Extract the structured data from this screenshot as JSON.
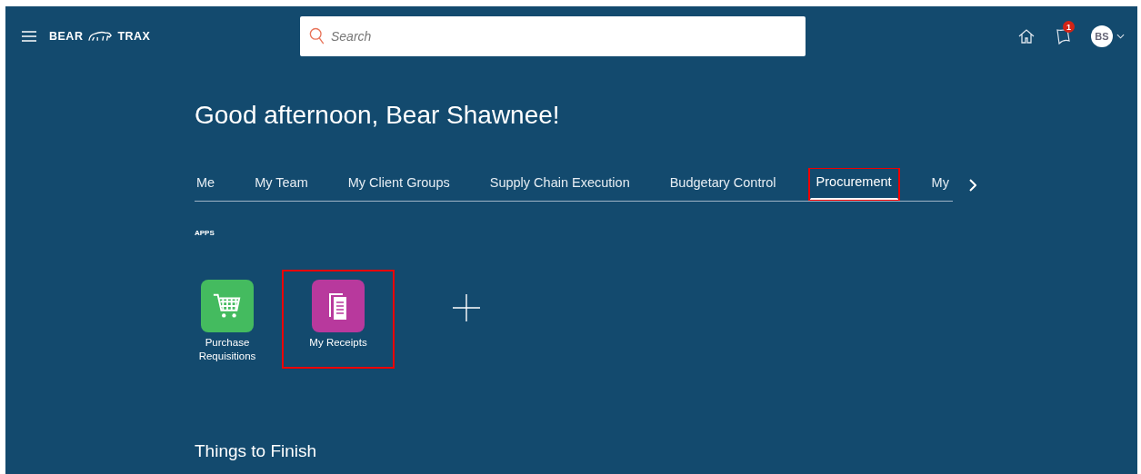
{
  "header": {
    "logo_left": "BEAR",
    "logo_right": "TRAX",
    "search": {
      "placeholder": "Search"
    },
    "notification_count": "1",
    "avatar_initials": "BS"
  },
  "greeting": "Good afternoon, Bear Shawnee!",
  "tabs": [
    {
      "label": "Me",
      "selected": false,
      "highlighted": false
    },
    {
      "label": "My Team",
      "selected": false,
      "highlighted": false
    },
    {
      "label": "My Client Groups",
      "selected": false,
      "highlighted": false
    },
    {
      "label": "Supply Chain Execution",
      "selected": false,
      "highlighted": false
    },
    {
      "label": "Budgetary Control",
      "selected": false,
      "highlighted": false
    },
    {
      "label": "Procurement",
      "selected": true,
      "highlighted": true
    },
    {
      "label": "My",
      "selected": false,
      "highlighted": false
    }
  ],
  "apps_heading": "APPS",
  "apps": [
    {
      "kind": "cart",
      "label": "Purchase Requisitions",
      "color": "#44bb5f",
      "highlighted": false
    },
    {
      "kind": "receipt",
      "label": "My Receipts",
      "color": "#b8399d",
      "highlighted": true
    }
  ],
  "section_title": "Things to Finish"
}
